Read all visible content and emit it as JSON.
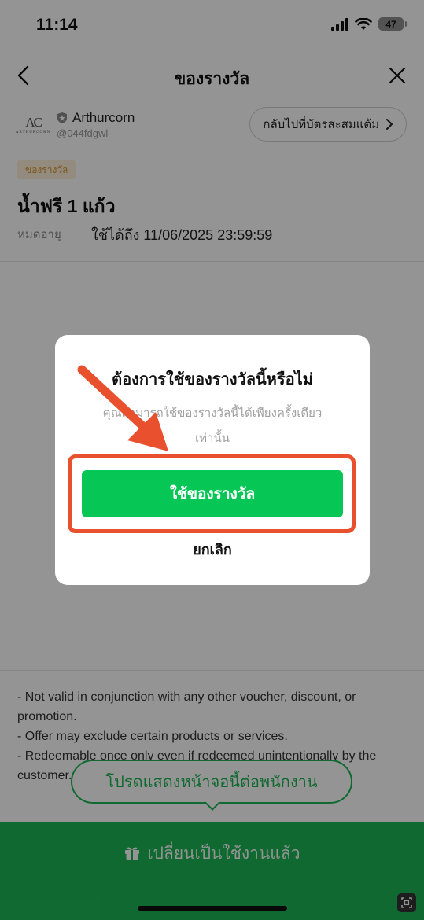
{
  "status": {
    "time": "11:14",
    "battery": "47"
  },
  "header": {
    "title": "ของรางวัล",
    "back_icon": "chevron-left-icon",
    "close_icon": "close-icon"
  },
  "shop": {
    "avatar_mono": "AC",
    "avatar_sub": "ARTHURCORN",
    "name": "Arthurcorn",
    "handle": "@044fdgwl",
    "back_to_card_label": "กลับไปที่บัตรสะสมแต้ม"
  },
  "reward": {
    "tag": "ของรางวัล",
    "title": "น้ำฟรี 1 แก้ว",
    "expire_label": "หมดอายุ",
    "expire_value": "ใช้ได้ถึง 11/06/2025 23:59:59"
  },
  "terms": [
    "- Not valid in conjunction with any other voucher, discount, or promotion.",
    "- Offer may exclude certain products or services.",
    "- Redeemable once only even if redeemed unintentionally by the customer."
  ],
  "tooltip": "โปรดแสดงหน้าจอนี้ต่อพนักงาน",
  "bottom_bar": {
    "label": "เปลี่ยนเป็นใช้งานแล้ว",
    "icon": "gift-icon"
  },
  "modal": {
    "title": "ต้องการใช้ของรางวัลนี้หรือไม่",
    "message": "คุณสามารถใช้ของรางวัลนี้ได้เพียงครั้งเดียวเท่านั้น",
    "confirm_label": "ใช้ของรางวัล",
    "cancel_label": "ยกเลิก"
  },
  "colors": {
    "brand_green": "#06c755",
    "annotation_red": "#e8502e"
  }
}
